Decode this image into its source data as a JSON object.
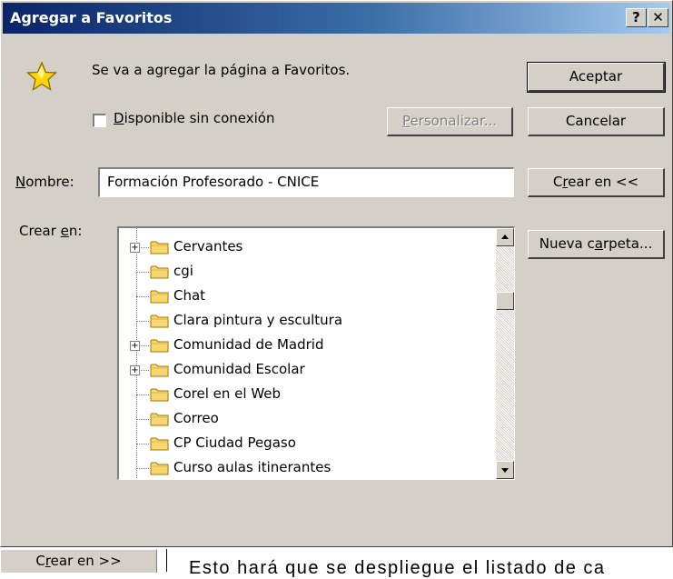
{
  "dialog": {
    "title": "Agregar a Favoritos",
    "help_button": "?",
    "close_button": "✕",
    "message": "Se va a agregar la página a Favoritos.",
    "checkbox": {
      "label_first": "D",
      "label_rest": "isponible sin conexión",
      "checked": false
    },
    "personalize_button": {
      "first": "P",
      "rest": "ersonalizar..."
    },
    "ok_button": "Aceptar",
    "cancel_button": "Cancelar",
    "name_label": {
      "first": "N",
      "rest": "ombre:"
    },
    "name_value": "Formación Profesorado - CNICE",
    "create_in_toggle": {
      "a": "C",
      "b": "r",
      "c": "ear en <<"
    },
    "create_in_label": {
      "a": "Crear ",
      "b": "e",
      "c": "n:"
    },
    "new_folder_button": {
      "a": "Nueva c",
      "b": "a",
      "c": "rpeta..."
    },
    "folders": [
      {
        "name": "Cervantes",
        "expandable": true
      },
      {
        "name": "cgi",
        "expandable": false
      },
      {
        "name": "Chat",
        "expandable": false
      },
      {
        "name": "Clara pintura y escultura",
        "expandable": false
      },
      {
        "name": "Comunidad de Madrid",
        "expandable": true
      },
      {
        "name": "Comunidad Escolar",
        "expandable": true
      },
      {
        "name": "Corel en el Web",
        "expandable": false
      },
      {
        "name": "Correo",
        "expandable": false
      },
      {
        "name": "CP Ciudad Pegaso",
        "expandable": false
      },
      {
        "name": "Curso aulas itinerantes",
        "expandable": false
      }
    ]
  },
  "bottom": {
    "button": {
      "a": "C",
      "b": "r",
      "c": "ear en >>"
    },
    "text": "Esto hará que se despliegue el listado de ca"
  }
}
